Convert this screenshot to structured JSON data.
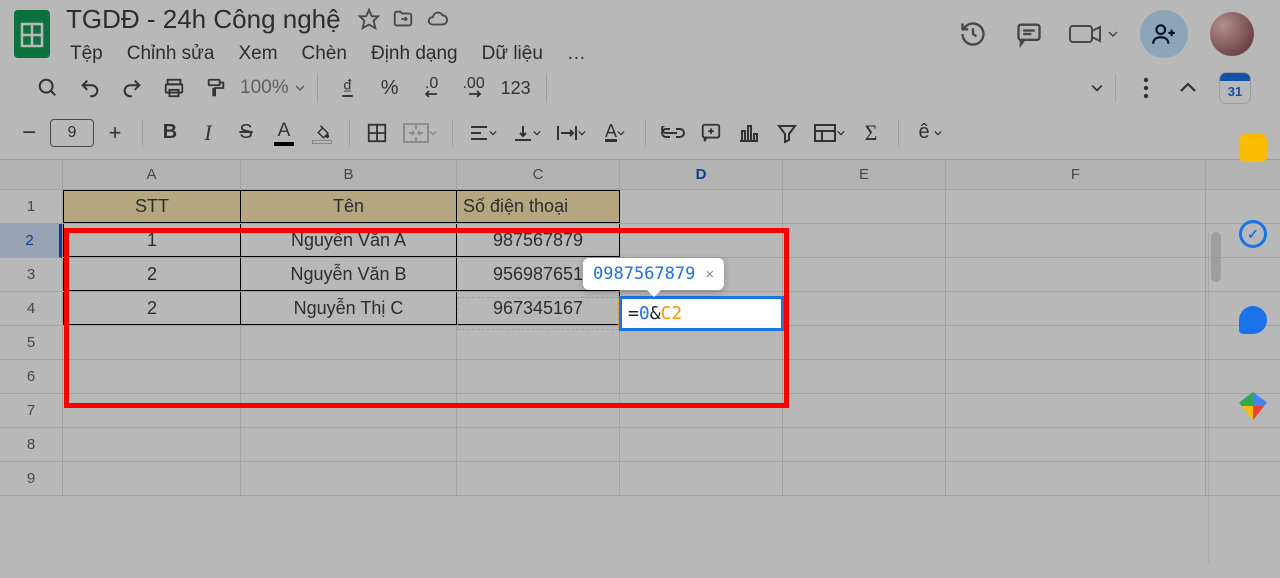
{
  "doc": {
    "title": "TGDĐ - 24h Công nghệ"
  },
  "menus": {
    "file": "Tệp",
    "edit": "Chỉnh sửa",
    "view": "Xem",
    "insert": "Chèn",
    "format": "Định dạng",
    "data": "Dữ liệu",
    "more": "…"
  },
  "toolbar": {
    "zoom": "100%",
    "currency": "₫",
    "percent": "%",
    "dec_dec": ".0",
    "inc_dec": ".00",
    "num_fmt": "123",
    "font_size": "9",
    "calendar_day": "31"
  },
  "columns": {
    "A": "A",
    "B": "B",
    "C": "C",
    "D": "D",
    "E": "E",
    "F": "F"
  },
  "rows": [
    "1",
    "2",
    "3",
    "4",
    "5",
    "6",
    "7",
    "8",
    "9"
  ],
  "table": {
    "headers": {
      "stt": "STT",
      "ten": "Tên",
      "sdt": "Số điện thoại"
    },
    "data": [
      {
        "stt": "1",
        "ten": "Nguyễn Văn A",
        "sdt": "987567879"
      },
      {
        "stt": "2",
        "ten": "Nguyễn Văn B",
        "sdt": "956987651"
      },
      {
        "stt": "2",
        "ten": "Nguyễn Thị C",
        "sdt": "967345167"
      }
    ]
  },
  "active": {
    "formula_eq": "=",
    "formula_num": "0",
    "formula_amp": "&",
    "formula_ref": "C2",
    "tooltip_value": "0987567879",
    "tooltip_close": "×"
  },
  "chart_data": {
    "type": "table",
    "columns": [
      "STT",
      "Tên",
      "Số điện thoại"
    ],
    "rows": [
      [
        "1",
        "Nguyễn Văn A",
        "987567879"
      ],
      [
        "2",
        "Nguyễn Văn B",
        "956987651"
      ],
      [
        "2",
        "Nguyễn Thị C",
        "967345167"
      ]
    ],
    "formula_cell": "D2",
    "formula": "=0&C2",
    "formula_result": "0987567879"
  }
}
